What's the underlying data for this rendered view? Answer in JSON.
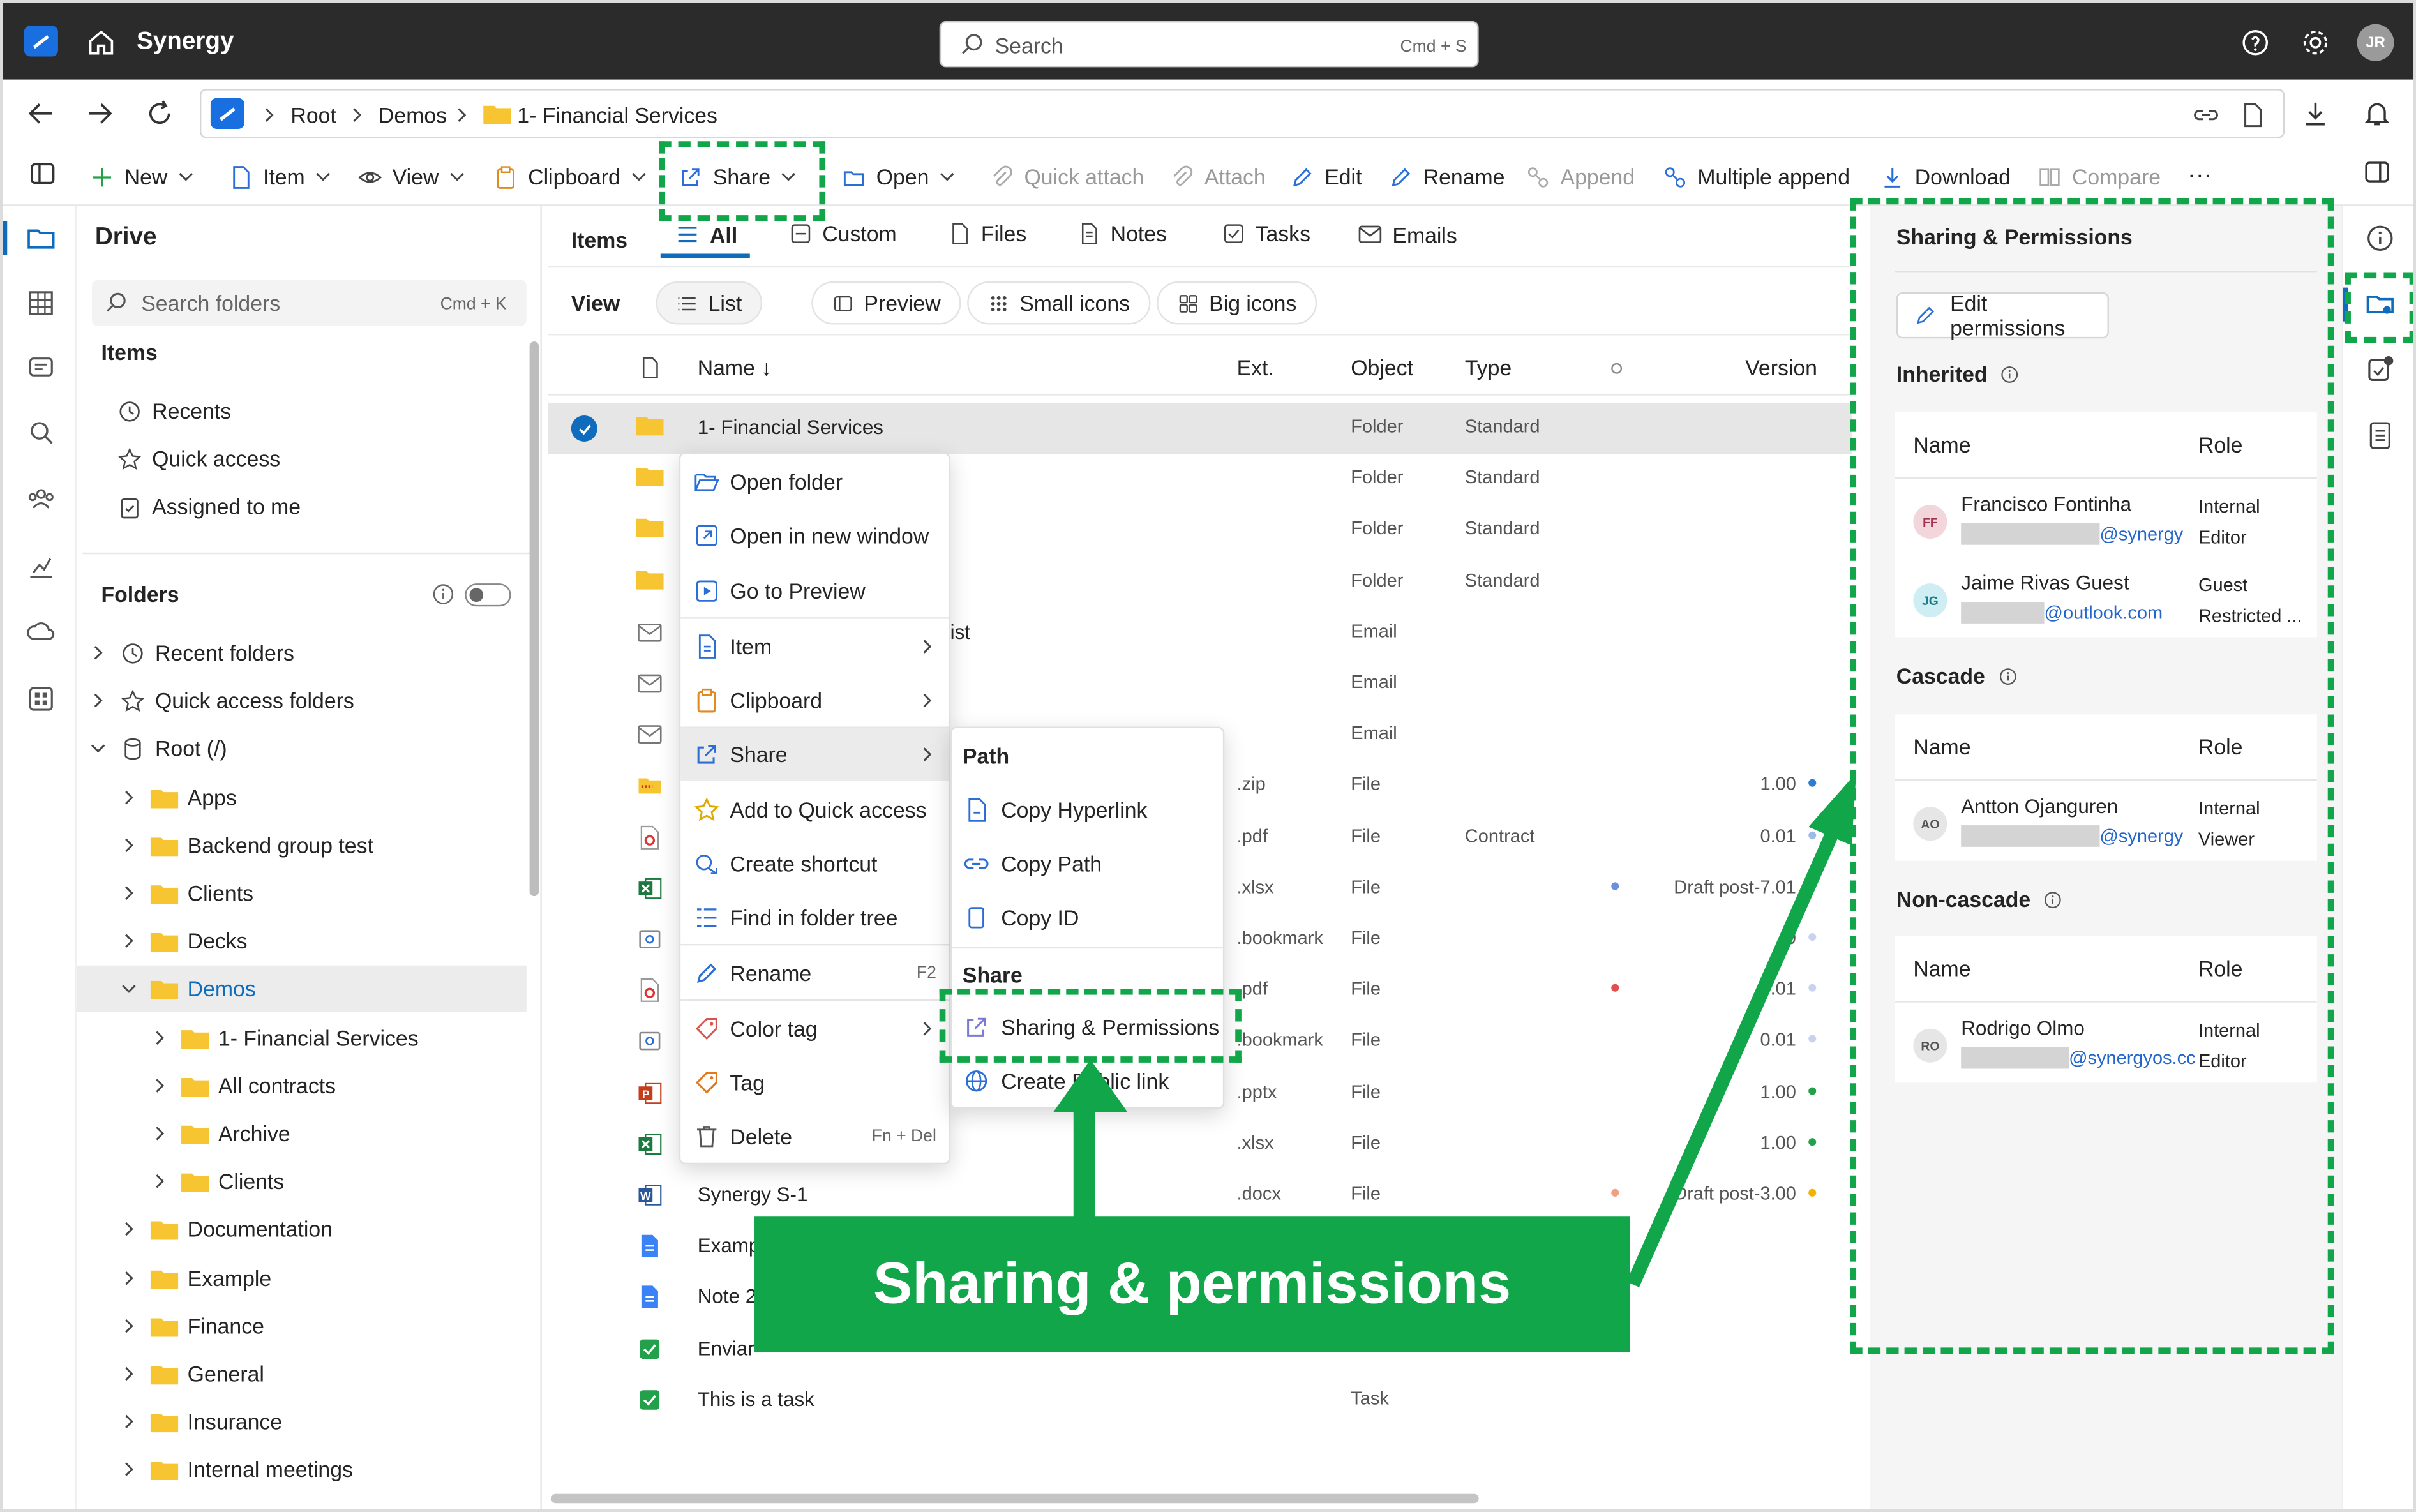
{
  "app": {
    "name": "Synergy",
    "search_placeholder": "Search",
    "search_shortcut": "Cmd + S",
    "user_initials": "JR"
  },
  "breadcrumb": [
    "Root",
    "Demos",
    "1- Financial Services"
  ],
  "toolbar": {
    "new": "New",
    "item": "Item",
    "view": "View",
    "clipboard": "Clipboard",
    "share": "Share",
    "open": "Open",
    "quick_attach": "Quick attach",
    "attach": "Attach",
    "edit": "Edit",
    "rename": "Rename",
    "append": "Append",
    "multiple_append": "Multiple append",
    "download": "Download",
    "compare": "Compare",
    "more": "···"
  },
  "sidebar": {
    "title": "Drive",
    "search_placeholder": "Search folders",
    "search_shortcut": "Cmd + K",
    "items_header": "Items",
    "items": [
      "Recents",
      "Quick access",
      "Assigned to me"
    ],
    "folders_header": "Folders",
    "tree": [
      {
        "label": "Recent folders",
        "level": 0,
        "kind": "clock"
      },
      {
        "label": "Quick access folders",
        "level": 0,
        "kind": "star"
      },
      {
        "label": "Root (/)",
        "level": 0,
        "kind": "db",
        "open": true
      },
      {
        "label": "Apps",
        "level": 1,
        "kind": "folder"
      },
      {
        "label": "Backend group test",
        "level": 1,
        "kind": "folder"
      },
      {
        "label": "Clients",
        "level": 1,
        "kind": "folder"
      },
      {
        "label": "Decks",
        "level": 1,
        "kind": "folder"
      },
      {
        "label": "Demos",
        "level": 1,
        "kind": "folder",
        "open": true,
        "selected": true
      },
      {
        "label": "1- Financial Services",
        "level": 2,
        "kind": "folder"
      },
      {
        "label": "All contracts",
        "level": 2,
        "kind": "folder"
      },
      {
        "label": "Archive",
        "level": 2,
        "kind": "folder"
      },
      {
        "label": "Clients",
        "level": 2,
        "kind": "folder"
      },
      {
        "label": "Documentation",
        "level": 1,
        "kind": "folder"
      },
      {
        "label": "Example",
        "level": 1,
        "kind": "folder"
      },
      {
        "label": "Finance",
        "level": 1,
        "kind": "folder"
      },
      {
        "label": "General",
        "level": 1,
        "kind": "folder"
      },
      {
        "label": "Insurance",
        "level": 1,
        "kind": "folder"
      },
      {
        "label": "Internal meetings",
        "level": 1,
        "kind": "folder"
      }
    ]
  },
  "tabs": {
    "label": "Items",
    "items": [
      "All",
      "Custom",
      "Files",
      "Notes",
      "Tasks",
      "Emails"
    ]
  },
  "view": {
    "label": "View",
    "options": [
      "List",
      "Preview",
      "Small icons",
      "Big icons"
    ]
  },
  "table": {
    "headers": {
      "name": "Name ↓",
      "ext": "Ext.",
      "object": "Object",
      "type": "Type",
      "version": "Version"
    },
    "rows": [
      {
        "name": "1- Financial Services",
        "ext": "",
        "object": "Folder",
        "type": "Standard",
        "version": "",
        "icon": "folder",
        "selected": true
      },
      {
        "name": "",
        "ext": "",
        "object": "Folder",
        "type": "Standard",
        "version": "",
        "icon": "folder"
      },
      {
        "name": "",
        "ext": "",
        "object": "Folder",
        "type": "Standard",
        "version": "",
        "icon": "folder"
      },
      {
        "name": "",
        "ext": "",
        "object": "Folder",
        "type": "Standard",
        "version": "",
        "icon": "folder"
      },
      {
        "name": "ist",
        "ext": "",
        "object": "Email",
        "type": "",
        "version": "",
        "icon": "mail"
      },
      {
        "name": "",
        "ext": "",
        "object": "Email",
        "type": "",
        "version": "",
        "icon": "mail"
      },
      {
        "name": "",
        "ext": "",
        "object": "Email",
        "type": "",
        "version": "",
        "icon": "mail"
      },
      {
        "name": "",
        "ext": ".zip",
        "object": "File",
        "type": "",
        "version": "1.00",
        "icon": "zip",
        "dot": "#2b7cd3"
      },
      {
        "name": "",
        "ext": ".pdf",
        "object": "File",
        "type": "Contract",
        "version": "0.01",
        "icon": "pdf",
        "dot": "#9bbbe8"
      },
      {
        "name": "",
        "ext": ".xlsx",
        "object": "File",
        "type": "",
        "version": "Draft post-7.01",
        "icon": "xlsx",
        "tag": "#6b8fe0"
      },
      {
        "name": "",
        "ext": ".bookmark",
        "object": "File",
        "type": "",
        "version": "0",
        "icon": "bookmark",
        "dot": "#c9d3f0"
      },
      {
        "name": "",
        "ext": ".pdf",
        "object": "File",
        "type": "",
        "version": "0.01",
        "icon": "pdf",
        "tag": "#e05050",
        "dot": "#c9d3f0"
      },
      {
        "name": "",
        "ext": ".bookmark",
        "object": "File",
        "type": "",
        "version": "0.01",
        "icon": "bookmark",
        "dot": "#c9d3f0"
      },
      {
        "name": "",
        "ext": ".pptx",
        "object": "File",
        "type": "",
        "version": "1.00",
        "icon": "pptx",
        "dot": "#22a04a"
      },
      {
        "name": "",
        "ext": ".xlsx",
        "object": "File",
        "type": "",
        "version": "1.00",
        "icon": "xlsx",
        "dot": "#22a04a"
      },
      {
        "name": "Synergy S-1",
        "ext": ".docx",
        "object": "File",
        "type": "",
        "version": "Draft post-3.00",
        "icon": "docx",
        "tag": "#f0a080",
        "dot": "#f0b400"
      },
      {
        "name": "Examp",
        "ext": "",
        "object": "",
        "type": "",
        "version": "",
        "icon": "note"
      },
      {
        "name": "Note 2",
        "ext": "",
        "object": "",
        "type": "",
        "version": "",
        "icon": "note"
      },
      {
        "name": "Enviar",
        "ext": "",
        "object": "",
        "type": "",
        "version": "",
        "icon": "task"
      },
      {
        "name": "This is a task",
        "ext": "",
        "object": "Task",
        "type": "",
        "version": "",
        "icon": "task"
      }
    ]
  },
  "context_menu": {
    "items": [
      {
        "label": "Open folder",
        "icon": "folder-open-icon"
      },
      {
        "label": "Open in new window",
        "icon": "new-window-icon"
      },
      {
        "label": "Go to Preview",
        "icon": "preview-icon"
      },
      {
        "label": "Item",
        "icon": "item-icon",
        "submenu": true
      },
      {
        "label": "Clipboard",
        "icon": "clipboard-icon",
        "submenu": true
      },
      {
        "label": "Share",
        "icon": "share-icon",
        "submenu": true,
        "active": true
      },
      {
        "label": "Add to Quick access",
        "icon": "star-icon"
      },
      {
        "label": "Create shortcut",
        "icon": "shortcut-icon"
      },
      {
        "label": "Find in folder tree",
        "icon": "tree-icon"
      },
      {
        "label": "Rename",
        "icon": "pencil-icon",
        "shortcut": "F2"
      },
      {
        "label": "Color tag",
        "icon": "color-tag-icon",
        "submenu": true
      },
      {
        "label": "Tag",
        "icon": "tag-icon"
      },
      {
        "label": "Delete",
        "icon": "trash-icon",
        "shortcut": "Fn + Del"
      }
    ]
  },
  "share_submenu": {
    "path_header": "Path",
    "path_items": [
      "Copy Hyperlink",
      "Copy Path",
      "Copy ID"
    ],
    "share_header": "Share",
    "share_items": [
      "Sharing & Permissions",
      "Create Public link"
    ]
  },
  "callout": {
    "text": "Sharing & permissions"
  },
  "permissions": {
    "title": "Sharing & Permissions",
    "edit_button": "Edit permissions",
    "sections": [
      {
        "title": "Inherited",
        "name_header": "Name",
        "role_header": "Role",
        "entries": [
          {
            "initials": "FF",
            "name": "Francisco Fontinha",
            "email": "@synergy",
            "kind": "Internal",
            "role": "Editor",
            "color": "#f3d5dc",
            "fg": "#a0324e"
          },
          {
            "initials": "JG",
            "name": "Jaime Rivas Guest",
            "email": "@outlook.com",
            "kind": "Guest",
            "role": "Restricted ...",
            "color": "#cfeef3",
            "fg": "#1a7c8c"
          }
        ]
      },
      {
        "title": "Cascade",
        "name_header": "Name",
        "role_header": "Role",
        "entries": [
          {
            "initials": "AO",
            "name": "Antton Ojanguren",
            "email": "@synergy",
            "kind": "Internal",
            "role": "Viewer",
            "color": "#e6e6e6",
            "fg": "#555555"
          }
        ]
      },
      {
        "title": "Non-cascade",
        "name_header": "Name",
        "role_header": "Role",
        "entries": [
          {
            "initials": "RO",
            "name": "Rodrigo Olmo",
            "email": "@synergyos.cc",
            "kind": "Internal",
            "role": "Editor",
            "color": "#e6e6e6",
            "fg": "#555555"
          }
        ]
      }
    ]
  },
  "colors": {
    "accent": "#0f6cbd",
    "highlight": "#12a64a",
    "topbar": "#2b2b2b",
    "folder": "#f7c531"
  }
}
